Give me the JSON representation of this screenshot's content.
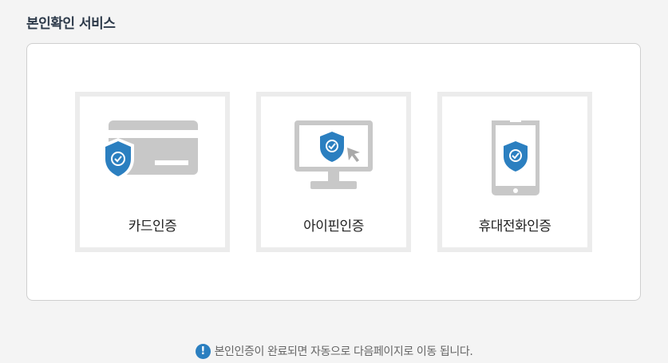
{
  "section": {
    "title": "본인확인 서비스"
  },
  "methods": [
    {
      "label": "카드인증",
      "icon": "card-shield-icon"
    },
    {
      "label": "아이핀인증",
      "icon": "monitor-shield-icon"
    },
    {
      "label": "휴대전화인증",
      "icon": "phone-shield-icon"
    }
  ],
  "notice": {
    "icon": "exclamation-icon",
    "text": "본인인증이 완료되면 자동으로 다음페이지로 이동 됩니다."
  },
  "colors": {
    "shield": "#2b7fc0",
    "device_gray": "#c8c8c8",
    "tile_border": "#ececec"
  }
}
